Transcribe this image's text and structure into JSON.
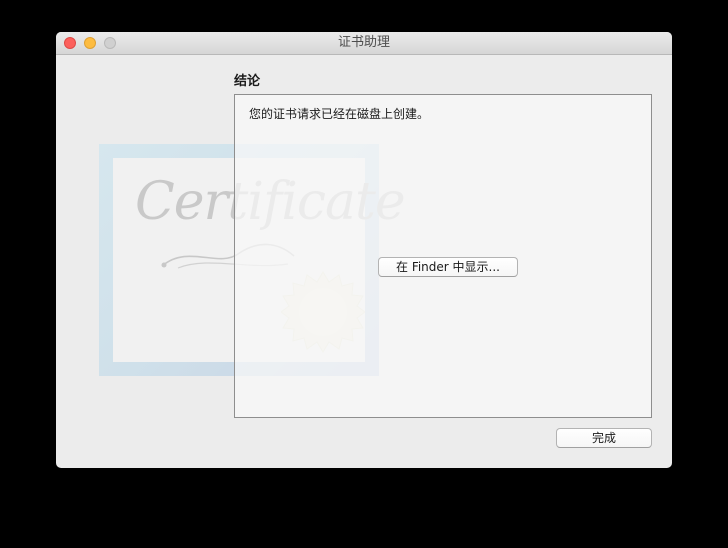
{
  "window": {
    "title": "证书助理"
  },
  "certificate_art": {
    "script_text": "Certificate"
  },
  "content": {
    "heading": "结论",
    "message": "您的证书请求已经在磁盘上创建。",
    "show_in_finder_label": "在 Finder 中显示..."
  },
  "footer": {
    "done_label": "完成"
  },
  "colors": {
    "close": "#fc605c",
    "minimize": "#fdbc40",
    "zoom_disabled": "#d0d0d0",
    "window_bg": "#ececec"
  }
}
